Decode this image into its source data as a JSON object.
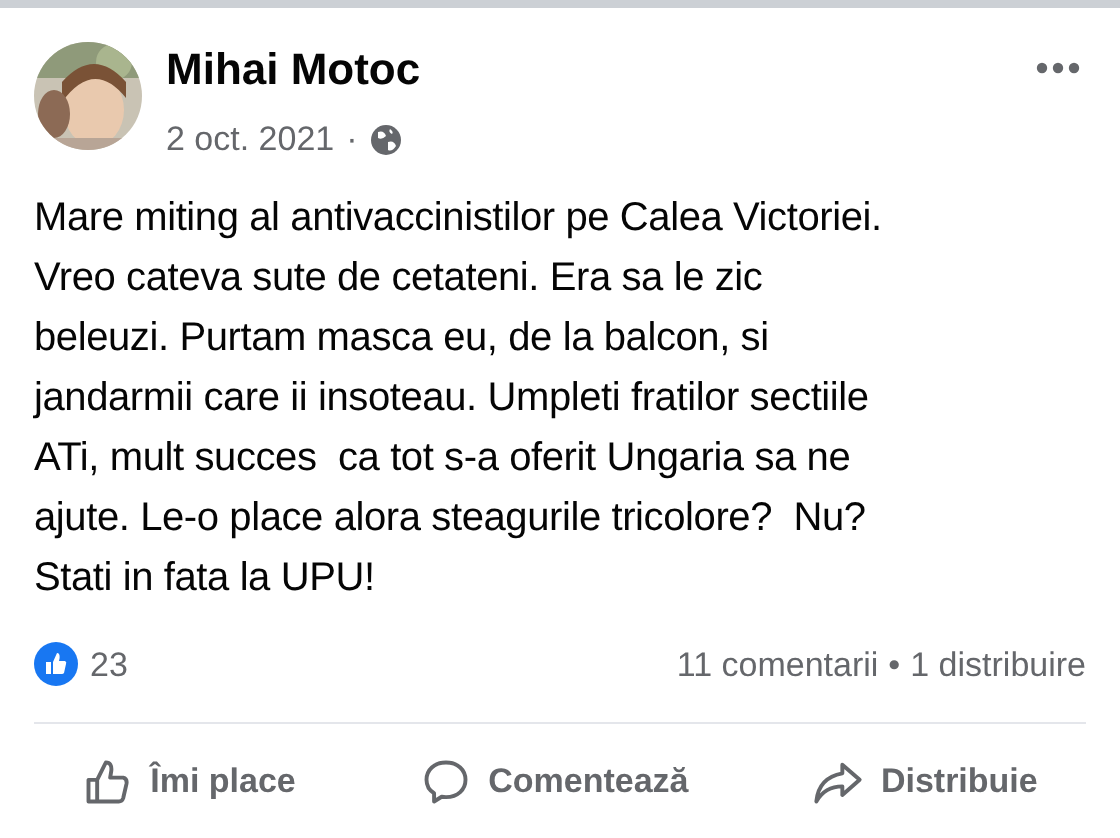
{
  "post": {
    "author": "Mihai Motoc",
    "date": "2 oct. 2021",
    "separator": "·",
    "text": "Mare miting al antivaccinistilor pe Calea Victoriei.\nVreo cateva sute de cetateni. Era sa le zic\nbeleuzi. Purtam masca eu, de la balcon, si\njandarmii care ii insoteau. Umpleti fratilor sectiile\nATi, mult succes  ca tot s-a oferit Ungaria sa ne\najute. Le-o place alora steagurile tricolore?  Nu?\nStati in fata la UPU!"
  },
  "reactions": {
    "count": "23",
    "comments": "11 comentarii",
    "dot": "•",
    "shares": "1 distribuire"
  },
  "actions": [
    {
      "kind": "like",
      "label": "Îmi place"
    },
    {
      "kind": "comment",
      "label": "Comentează"
    },
    {
      "kind": "share",
      "label": "Distribuie"
    }
  ]
}
